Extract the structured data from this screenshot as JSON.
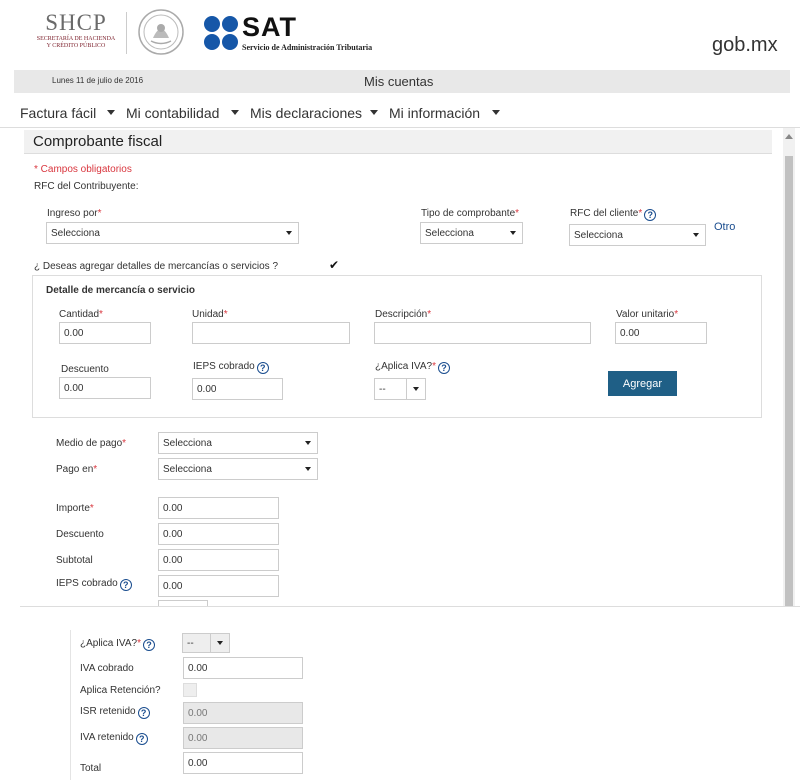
{
  "header": {
    "shcp": "SHCP",
    "shcp_sub1": "SECRETARÍA DE HACIENDA",
    "shcp_sub2": "Y CRÉDITO PÚBLICO",
    "sat": "SAT",
    "sat_sub": "Servicio de Administración Tributaria",
    "gob": "gob.mx"
  },
  "datebar": {
    "date": "Lunes 11 de julio de 2016",
    "title": "Mis cuentas"
  },
  "nav": {
    "items": [
      "Factura fácil",
      "Mi contabilidad",
      "Mis declaraciones",
      "Mi información"
    ]
  },
  "section": {
    "title": "Comprobante fiscal"
  },
  "form": {
    "required_note": "* Campos obligatorios",
    "rfc_contribuyente": "RFC del Contribuyente:",
    "ingreso_label": "Ingreso por",
    "ingreso_value": "Selecciona",
    "tipo_label": "Tipo de comprobante",
    "tipo_value": "Selecciona",
    "rfc_cliente_label": "RFC del cliente",
    "rfc_cliente_value": "Selecciona",
    "otro": "Otro",
    "detalles_question": "¿ Deseas agregar detalles de mercancías o servicios ?",
    "asterisk": "*",
    "help": "?"
  },
  "detail": {
    "title": "Detalle de mercancía o servicio",
    "cantidad_label": "Cantidad",
    "cantidad_value": "0.00",
    "unidad_label": "Unidad",
    "descripcion_label": "Descripción",
    "valor_label": "Valor unitario",
    "valor_value": "0.00",
    "descuento_label": "Descuento",
    "descuento_value": "0.00",
    "ieps_label": "IEPS cobrado",
    "ieps_value": "0.00",
    "iva_label": "¿Aplica IVA?",
    "iva_value": "--",
    "agregar": "Agregar"
  },
  "pago": {
    "medio_label": "Medio de pago",
    "medio_value": "Selecciona",
    "pagoen_label": "Pago en",
    "pagoen_value": "Selecciona",
    "importe_label": "Importe",
    "importe_value": "0.00",
    "descuento_label": "Descuento",
    "descuento_value": "0.00",
    "subtotal_label": "Subtotal",
    "subtotal_value": "0.00",
    "ieps_label": "IEPS cobrado",
    "ieps_value": "0.00"
  },
  "totals": {
    "iva_label": "¿Aplica IVA?",
    "iva_value": "--",
    "iva_cobrado_label": "IVA cobrado",
    "iva_cobrado_value": "0.00",
    "retencion_label": "Aplica Retención?",
    "isr_label": "ISR retenido",
    "isr_value": "0.00",
    "iva_ret_label": "IVA retenido",
    "iva_ret_value": "0.00",
    "total_label": "Total",
    "total_value": "0.00"
  },
  "colors": {
    "accent": "#1f5f86",
    "required": "#d9363e",
    "link": "#1a4d8f"
  }
}
